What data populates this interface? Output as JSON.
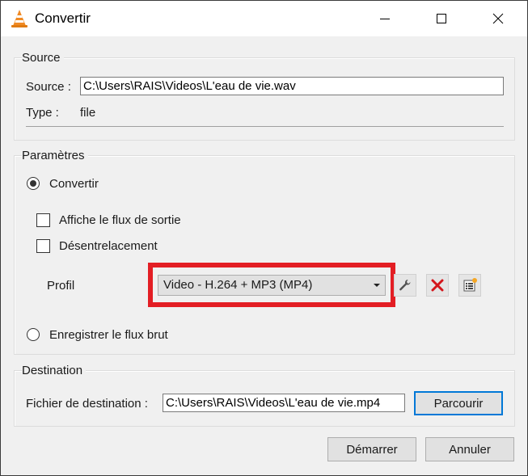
{
  "window": {
    "title": "Convertir",
    "icon": "vlc-cone-icon",
    "controls": {
      "minimize": "minimize-icon",
      "maximize": "maximize-icon",
      "close": "close-icon"
    }
  },
  "source_group": {
    "title": "Source",
    "source_label": "Source :",
    "source_value": "C:\\Users\\RAIS\\Videos\\L'eau de vie.wav",
    "type_label": "Type :",
    "type_value": "file"
  },
  "params_group": {
    "title": "Paramètres",
    "convert_radio": {
      "label": "Convertir",
      "checked": true
    },
    "show_output_checkbox": {
      "label": "Affiche le flux de sortie",
      "checked": false
    },
    "deinterlace_checkbox": {
      "label": "Désentrelacement",
      "checked": false
    },
    "profile_label": "Profil",
    "profile_selected": "Video - H.264 + MP3 (MP4)",
    "profile_tools": [
      {
        "name": "edit-profile",
        "icon": "wrench-icon"
      },
      {
        "name": "delete-profile",
        "icon": "red-x-icon"
      },
      {
        "name": "new-profile",
        "icon": "new-list-icon"
      }
    ],
    "raw_dump_radio": {
      "label": "Enregistrer le flux brut",
      "checked": false
    },
    "highlight_color": "#e31e24"
  },
  "destination_group": {
    "title": "Destination",
    "file_label": "Fichier de destination :",
    "file_value": "C:\\Users\\RAIS\\Videos\\L'eau de vie.mp4",
    "browse_button": "Parcourir"
  },
  "footer": {
    "start_button": "Démarrer",
    "cancel_button": "Annuler"
  }
}
